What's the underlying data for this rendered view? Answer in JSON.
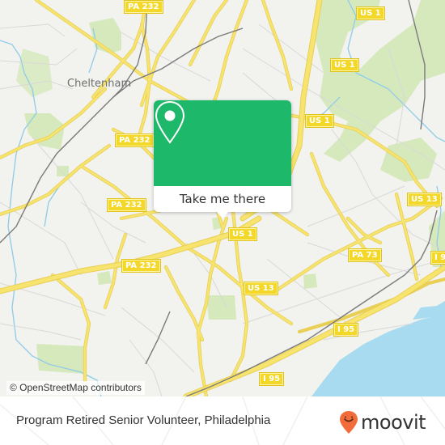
{
  "map": {
    "place_labels": [
      {
        "name": "cheltenham",
        "text": "Cheltenham"
      }
    ],
    "route_shields": [
      {
        "text": "PA 232"
      },
      {
        "text": "US 1"
      },
      {
        "text": "US 1"
      },
      {
        "text": "US 1"
      },
      {
        "text": "PA 232"
      },
      {
        "text": "PA 232"
      },
      {
        "text": "PA 232"
      },
      {
        "text": "US 13"
      },
      {
        "text": "US 1"
      },
      {
        "text": "US 13"
      },
      {
        "text": "PA 73"
      },
      {
        "text": "I 95"
      },
      {
        "text": "I 95"
      },
      {
        "text": "I 9"
      }
    ],
    "attribution": "© OpenStreetMap contributors",
    "colors": {
      "background": "#f2f2ef",
      "road": "#f7e46e",
      "park": "#d3e8b5",
      "water": "#a8dbef",
      "rail": "#777777"
    }
  },
  "popup": {
    "button_label": "Take me there",
    "icon": "map-pin-icon",
    "color": "#1eb86a"
  },
  "footer": {
    "title": "Program Retired Senior Volunteer, Philadelphia",
    "logo_text": "moovit",
    "logo_color": "#f26b3a"
  }
}
